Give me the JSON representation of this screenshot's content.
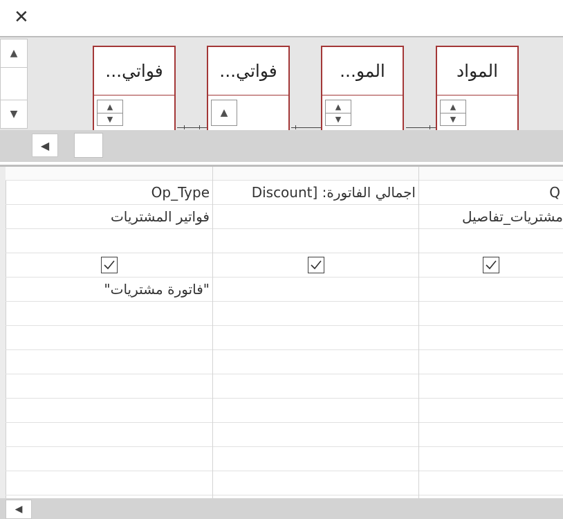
{
  "window": {
    "close_glyph": "✕"
  },
  "tables": [
    {
      "name": "فواتي...",
      "spinner": "double"
    },
    {
      "name": "فواتي...",
      "spinner": "single"
    },
    {
      "name": "المو...",
      "spinner": "double"
    },
    {
      "name": "المواد",
      "spinner": "double"
    }
  ],
  "grid": {
    "columns": [
      {
        "field": "Op_Type",
        "table": "فواتير المشتريات",
        "show": true,
        "criteria": "\"فاتورة مشتريات\""
      },
      {
        "field": "اجمالي الفاتورة: [Discount",
        "table": "",
        "show": true,
        "criteria": ""
      },
      {
        "field": "Q",
        "table": "مشتريات_تفاصيل",
        "show": true,
        "criteria": ""
      }
    ]
  },
  "icons": {
    "close": "close-icon",
    "scroll_up": "arrow-up-icon",
    "scroll_down": "arrow-down-icon",
    "scroll_left": "arrow-left-icon",
    "checkbox": "checkbox-checked-icon"
  }
}
